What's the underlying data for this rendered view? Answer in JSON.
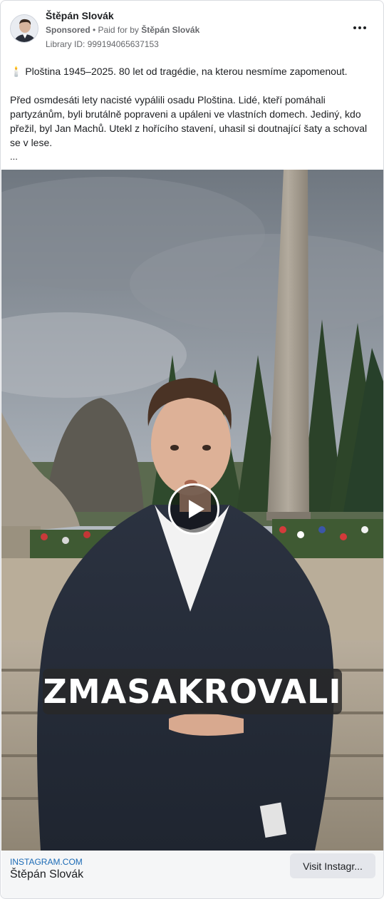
{
  "ad": {
    "advertiser_name": "Štěpán Slovák",
    "sponsored_label": "Sponsored",
    "separator": " • ",
    "paid_for_prefix": "Paid for by ",
    "paid_for_name": "Štěpán Slovák",
    "library_id": "Library ID: 999194065637153"
  },
  "post": {
    "paragraph1": "🕯️ Ploština 1945–2025. 80 let od tragédie, na kterou nesmíme zapomenout.",
    "paragraph2": "Před osmdesáti lety nacisté vypálili osadu Ploština. Lidé, kteří pomáhali partyzánům, byli brutálně popraveni a upáleni ve vlastních domech. Jediný, kdo přežil, byl Jan Machů. Utekl z hořícího stavení, uhasil si doutnající šaty a schoval se v lese.",
    "truncation": "..."
  },
  "video": {
    "caption": "ZMASAKROVALI",
    "play_icon": "play-icon"
  },
  "link": {
    "domain": "INSTAGRAM.COM",
    "title": "Štěpán Slovák",
    "cta_label": "Visit Instagr..."
  },
  "colors": {
    "link_blue": "#1b6ab5",
    "secondary_text": "#65676b",
    "footer_bg": "#f5f6f7",
    "button_bg": "#e4e6eb"
  }
}
